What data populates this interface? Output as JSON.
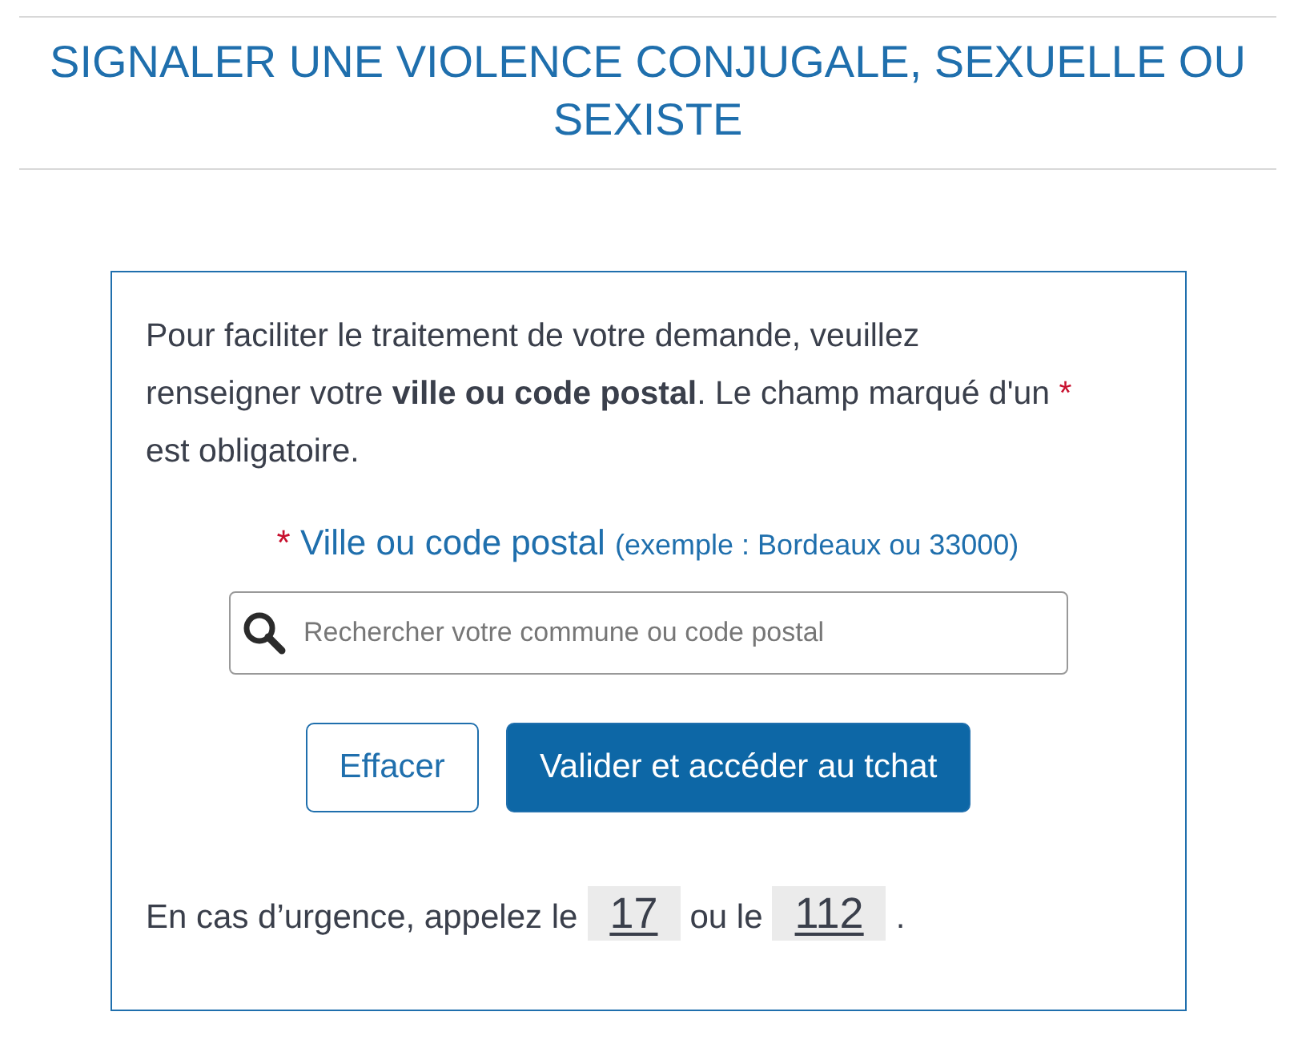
{
  "title": "SIGNALER UNE VIOLENCE CONJUGALE, SEXUELLE OU SEXISTE",
  "intro": {
    "before": "Pour faciliter le traitement de votre demande, veuillez renseigner votre **ville ou code postal**. Le champ marqué d'un",
    "required_mark": "*",
    "after": "est obligatoire."
  },
  "field": {
    "required_mark": "*",
    "label": "Ville ou code postal",
    "hint": "(exemple : Bordeaux ou 33000)",
    "placeholder": "Rechercher votre commune ou code postal"
  },
  "buttons": [
    {
      "label": "Effacer",
      "kind": "secondary"
    },
    {
      "label": "Valider et accéder au tchat",
      "kind": "primary"
    }
  ],
  "emergency": {
    "before": "En cas d’urgence, appelez le",
    "number_1": "17",
    "middle": "ou le",
    "number_2": "112",
    "after": "."
  }
}
